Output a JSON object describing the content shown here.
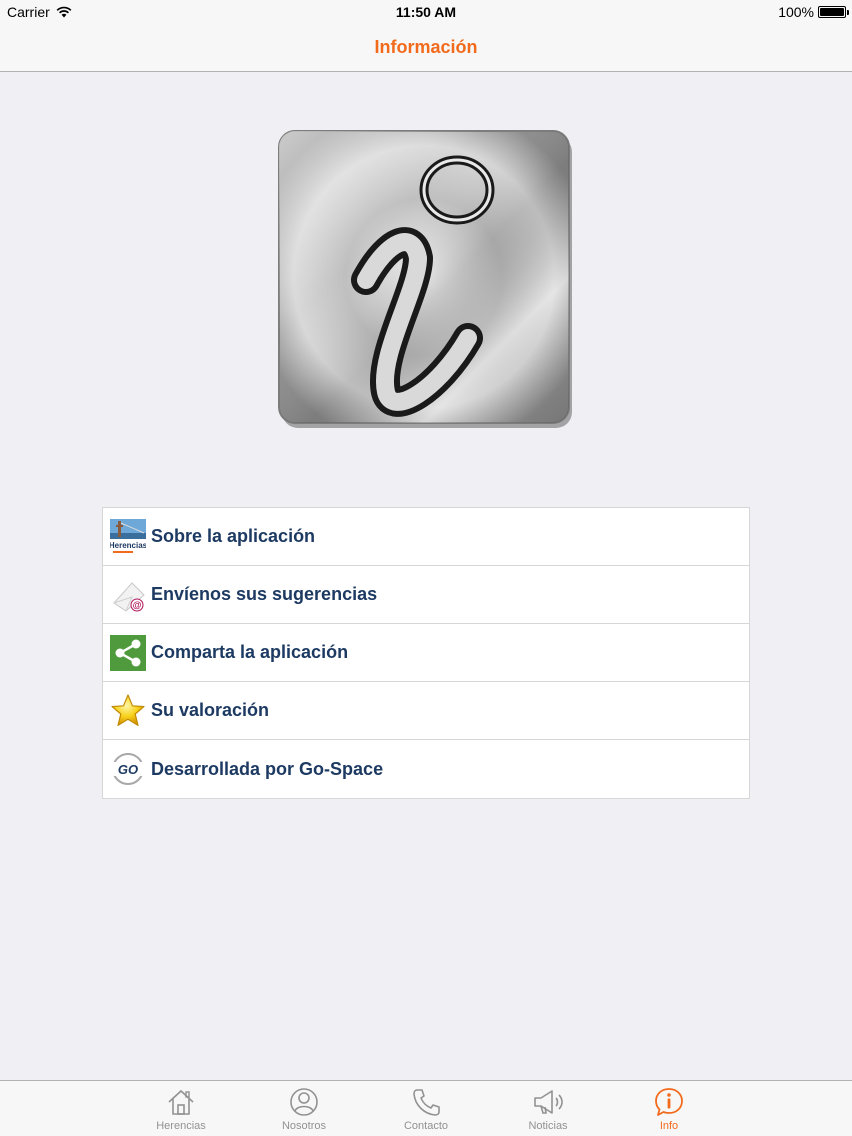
{
  "status_bar": {
    "carrier": "Carrier",
    "time": "11:50 AM",
    "battery": "100%"
  },
  "nav": {
    "title": "Información"
  },
  "menu": [
    {
      "label": "Sobre la aplicación",
      "icon": "herencias-logo-icon"
    },
    {
      "label": "Envíenos sus sugerencias",
      "icon": "email-icon"
    },
    {
      "label": "Comparta la aplicación",
      "icon": "share-icon"
    },
    {
      "label": "Su valoración",
      "icon": "star-icon"
    },
    {
      "label": "Desarrollada por Go-Space",
      "icon": "gospace-logo-icon"
    }
  ],
  "logo_text": {
    "herencias": "Herencias",
    "go": "GO"
  },
  "tabs": [
    {
      "label": "Herencias",
      "icon": "home-icon",
      "active": false
    },
    {
      "label": "Nosotros",
      "icon": "person-icon",
      "active": false
    },
    {
      "label": "Contacto",
      "icon": "phone-icon",
      "active": false
    },
    {
      "label": "Noticias",
      "icon": "megaphone-icon",
      "active": false
    },
    {
      "label": "Info",
      "icon": "info-icon",
      "active": true
    }
  ],
  "colors": {
    "accent": "#f26b1d",
    "menu_text": "#1d3a62",
    "tab_inactive": "#929292",
    "background": "#efeff4"
  }
}
